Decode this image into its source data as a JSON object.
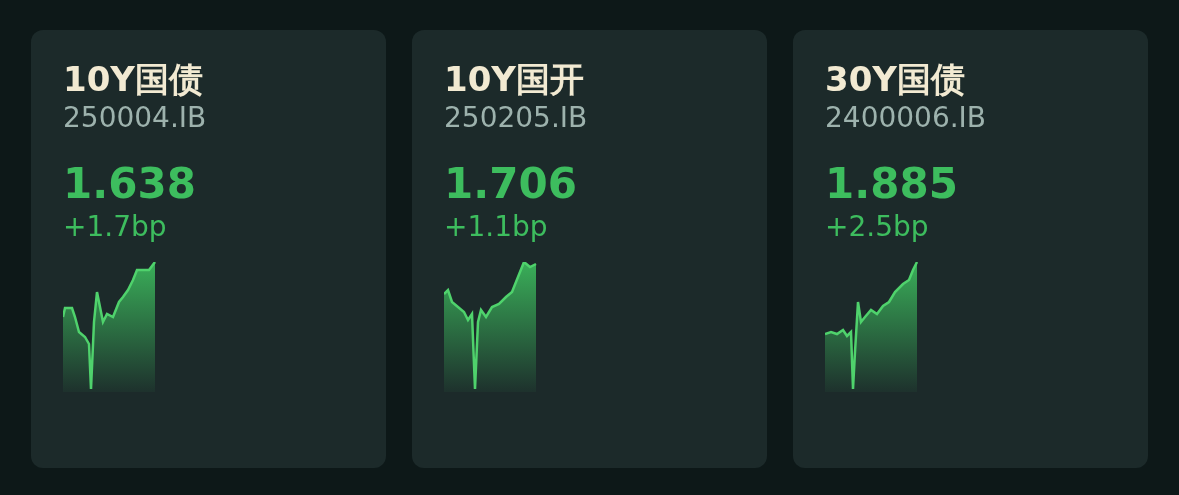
{
  "cards": [
    {
      "title": "10Y国债",
      "code": "250004.IB",
      "yield": "1.638",
      "change": "+1.7bp"
    },
    {
      "title": "10Y国开",
      "code": "250205.IB",
      "yield": "1.706",
      "change": "+1.1bp"
    },
    {
      "title": "30Y国债",
      "code": "2400006.IB",
      "yield": "1.885",
      "change": "+2.5bp"
    }
  ]
}
